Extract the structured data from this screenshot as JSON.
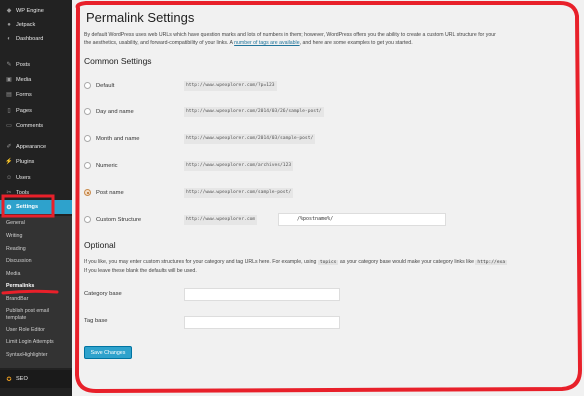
{
  "sidebar": {
    "items": [
      {
        "icon": "wp-engine-icon",
        "label": "WP Engine"
      },
      {
        "icon": "jetpack-icon",
        "label": "Jetpack"
      },
      {
        "icon": "dashboard-icon",
        "label": "Dashboard"
      },
      {
        "icon": "posts-icon",
        "label": "Posts"
      },
      {
        "icon": "media-icon",
        "label": "Media"
      },
      {
        "icon": "forms-icon",
        "label": "Forms"
      },
      {
        "icon": "pages-icon",
        "label": "Pages"
      },
      {
        "icon": "comments-icon",
        "label": "Comments"
      },
      {
        "icon": "appearance-icon",
        "label": "Appearance"
      },
      {
        "icon": "plugins-icon",
        "label": "Plugins"
      },
      {
        "icon": "users-icon",
        "label": "Users"
      },
      {
        "icon": "tools-icon",
        "label": "Tools"
      },
      {
        "icon": "settings-icon",
        "label": "Settings"
      }
    ],
    "submenu": [
      "General",
      "Writing",
      "Reading",
      "Discussion",
      "Media",
      "Permalinks",
      "BrandBar",
      "Publish post email",
      "template",
      "User Role Editor",
      "Limit Login Attempts",
      "SyntaxHighlighter"
    ],
    "bottom": {
      "icon": "seo-icon",
      "label": "SEO"
    }
  },
  "main": {
    "title": "Permalink Settings",
    "intro_before": "By default WordPress uses web URLs which have question marks and lots of numbers in them; however, WordPress offers you the ability to create a custom URL structure for your",
    "intro_line2_a": "the aesthetics, usability, and forward-compatibility of your links. A ",
    "intro_link": "number of tags are available",
    "intro_line2_b": ", and here are some examples to get you started.",
    "common_heading": "Common Settings",
    "options": [
      {
        "label": "Default",
        "example": "http://www.wpexplorer.com/?p=123",
        "selected": false
      },
      {
        "label": "Day and name",
        "example": "http://www.wpexplorer.com/2014/03/26/sample-post/",
        "selected": false
      },
      {
        "label": "Month and name",
        "example": "http://www.wpexplorer.com/2014/03/sample-post/",
        "selected": false
      },
      {
        "label": "Numeric",
        "example": "http://www.wpexplorer.com/archives/123",
        "selected": false
      },
      {
        "label": "Post name",
        "example": "http://www.wpexplorer.com/sample-post/",
        "selected": true
      },
      {
        "label": "Custom Structure",
        "example": "http://www.wpexplorer.com",
        "value": "/%postname%/",
        "selected": false
      }
    ],
    "optional_heading": "Optional",
    "optional_text_a": "If you like, you may enter custom structures for your category and tag URLs here. For example, using ",
    "optional_code": "topics",
    "optional_text_b": " as your category base would make your category links like ",
    "optional_code2": "http://exa",
    "optional_text_c": "If you leave these blank the defaults will be used.",
    "category_base_label": "Category base",
    "tag_base_label": "Tag base",
    "save_label": "Save Changes"
  },
  "colors": {
    "annotation": "#e8202a",
    "accent": "#2ea2cc",
    "sidebar": "#222222"
  }
}
